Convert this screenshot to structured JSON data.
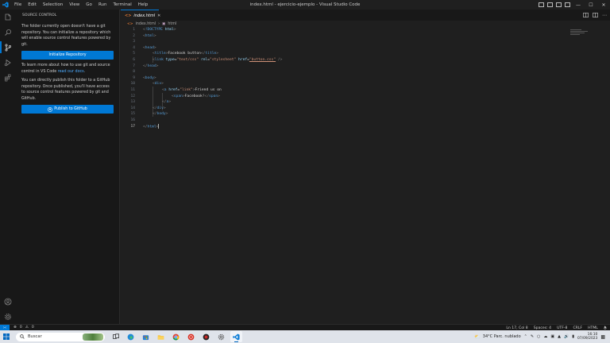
{
  "titlebar": {
    "menu": [
      "File",
      "Edit",
      "Selection",
      "View",
      "Go",
      "Run",
      "Terminal",
      "Help"
    ],
    "window_title": "index.html - ejercicio-ejemplo - Visual Studio Code"
  },
  "activitybar": {
    "top_icons": [
      "explorer-icon",
      "search-icon",
      "source-control-icon",
      "run-debug-icon",
      "extensions-icon"
    ],
    "bottom_icons": [
      "accounts-icon",
      "manage-gear-icon"
    ]
  },
  "sidebar": {
    "title": "SOURCE CONTROL",
    "intro": "The folder currently open doesn't have a git repository. You can initialize a repository which will enable source control features powered by git.",
    "init_button": "Initialize Repository",
    "learn_text": "To learn more about how to use git and source control in VS Code ",
    "learn_link": "read our docs",
    "learn_end": ".",
    "publish_text": "You can directly publish this folder to a GitHub repository. Once published, you'll have access to source control features powered by git and GitHub.",
    "publish_button": "Publish to GitHub"
  },
  "editor": {
    "tab_label": "index.html",
    "breadcrumb": [
      "index.html",
      "html"
    ],
    "current_line": 17
  },
  "code": [
    {
      "n": "1",
      "t": "<!DOCTYPE html>"
    },
    {
      "n": "2",
      "t": "<html>"
    },
    {
      "n": "3",
      "t": ""
    },
    {
      "n": "4",
      "t": "<head>"
    },
    {
      "n": "5",
      "t": "<title>Facebook button</title>"
    },
    {
      "n": "6",
      "t": "<link type=\"text/css\" rel=\"stylesheet\" href=\"button.css\" />"
    },
    {
      "n": "7",
      "t": "</head>"
    },
    {
      "n": "8",
      "t": ""
    },
    {
      "n": "9",
      "t": "<body>"
    },
    {
      "n": "10",
      "t": "<div>"
    },
    {
      "n": "11",
      "t": "<a href=\"link\">Friend us on"
    },
    {
      "n": "12",
      "t": "<span>Facebook!</span>"
    },
    {
      "n": "13",
      "t": "</a>"
    },
    {
      "n": "14",
      "t": "</div>"
    },
    {
      "n": "15",
      "t": "</body>"
    },
    {
      "n": "16",
      "t": ""
    },
    {
      "n": "17",
      "t": "</html>"
    }
  ],
  "statusbar": {
    "problems": "0",
    "warnings": "0",
    "position": "Ln 17, Col 8",
    "spaces": "Spaces: 4",
    "encoding": "UTF-8",
    "eol": "CRLF",
    "language": "HTML"
  },
  "taskbar": {
    "search_placeholder": "Buscar",
    "weather": "34°C  Parc. nublado",
    "time": "16:10",
    "date": "07/09/2023"
  },
  "colors": {
    "accent": "#0078d4",
    "tag": "#569cd6",
    "attr": "#9cdcfe",
    "string": "#ce9178"
  }
}
